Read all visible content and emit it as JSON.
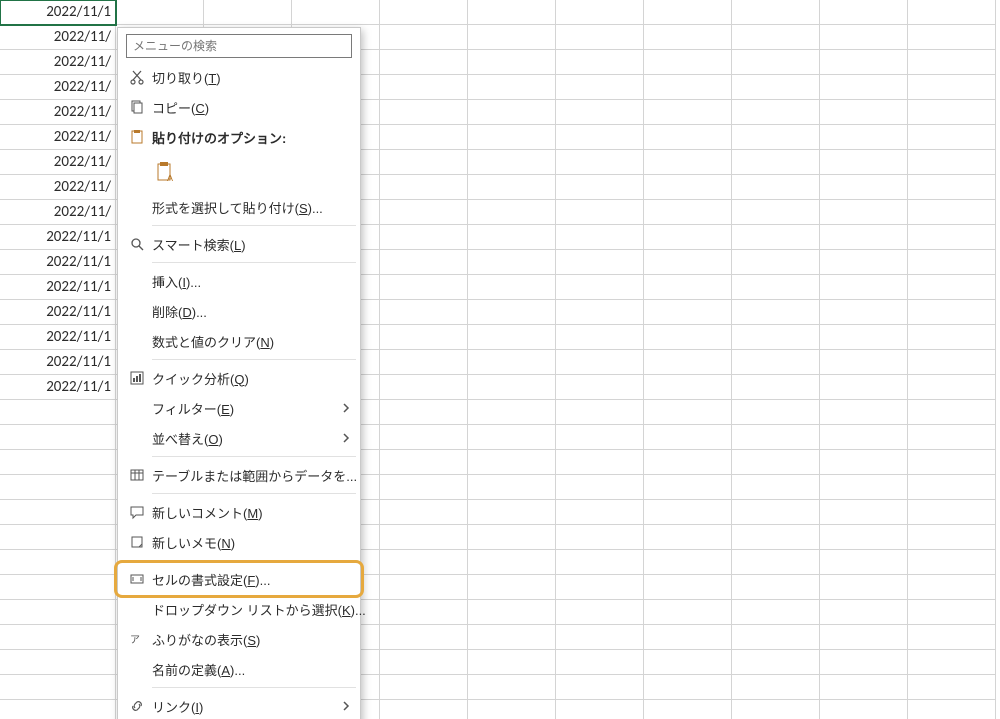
{
  "dates": [
    "2022/11/1",
    "2022/11/",
    "2022/11/",
    "2022/11/",
    "2022/11/",
    "2022/11/",
    "2022/11/",
    "2022/11/",
    "2022/11/",
    "2022/11/1",
    "2022/11/1",
    "2022/11/1",
    "2022/11/1",
    "2022/11/1",
    "2022/11/1",
    "2022/11/1"
  ],
  "menu": {
    "search_placeholder": "メニューの検索",
    "cut": "切り取り(T)",
    "copy": "コピー(C)",
    "paste_options_header": "貼り付けのオプション:",
    "paste_special": "形式を選択して貼り付け(S)...",
    "smart_lookup": "スマート検索(L)",
    "insert": "挿入(I)...",
    "delete": "削除(D)...",
    "clear_contents": "数式と値のクリア(N)",
    "quick_analysis": "クイック分析(Q)",
    "filter": "フィルター(E)",
    "sort": "並べ替え(O)",
    "table_data": "テーブルまたは範囲からデータを...",
    "new_comment": "新しいコメント(M)",
    "new_note": "新しいメモ(N)",
    "format_cells": "セルの書式設定(F)...",
    "dropdown_list": "ドロップダウン リストから選択(K)...",
    "show_phonetic": "ふりがなの表示(S)",
    "define_name": "名前の定義(A)...",
    "link": "リンク(I)"
  }
}
